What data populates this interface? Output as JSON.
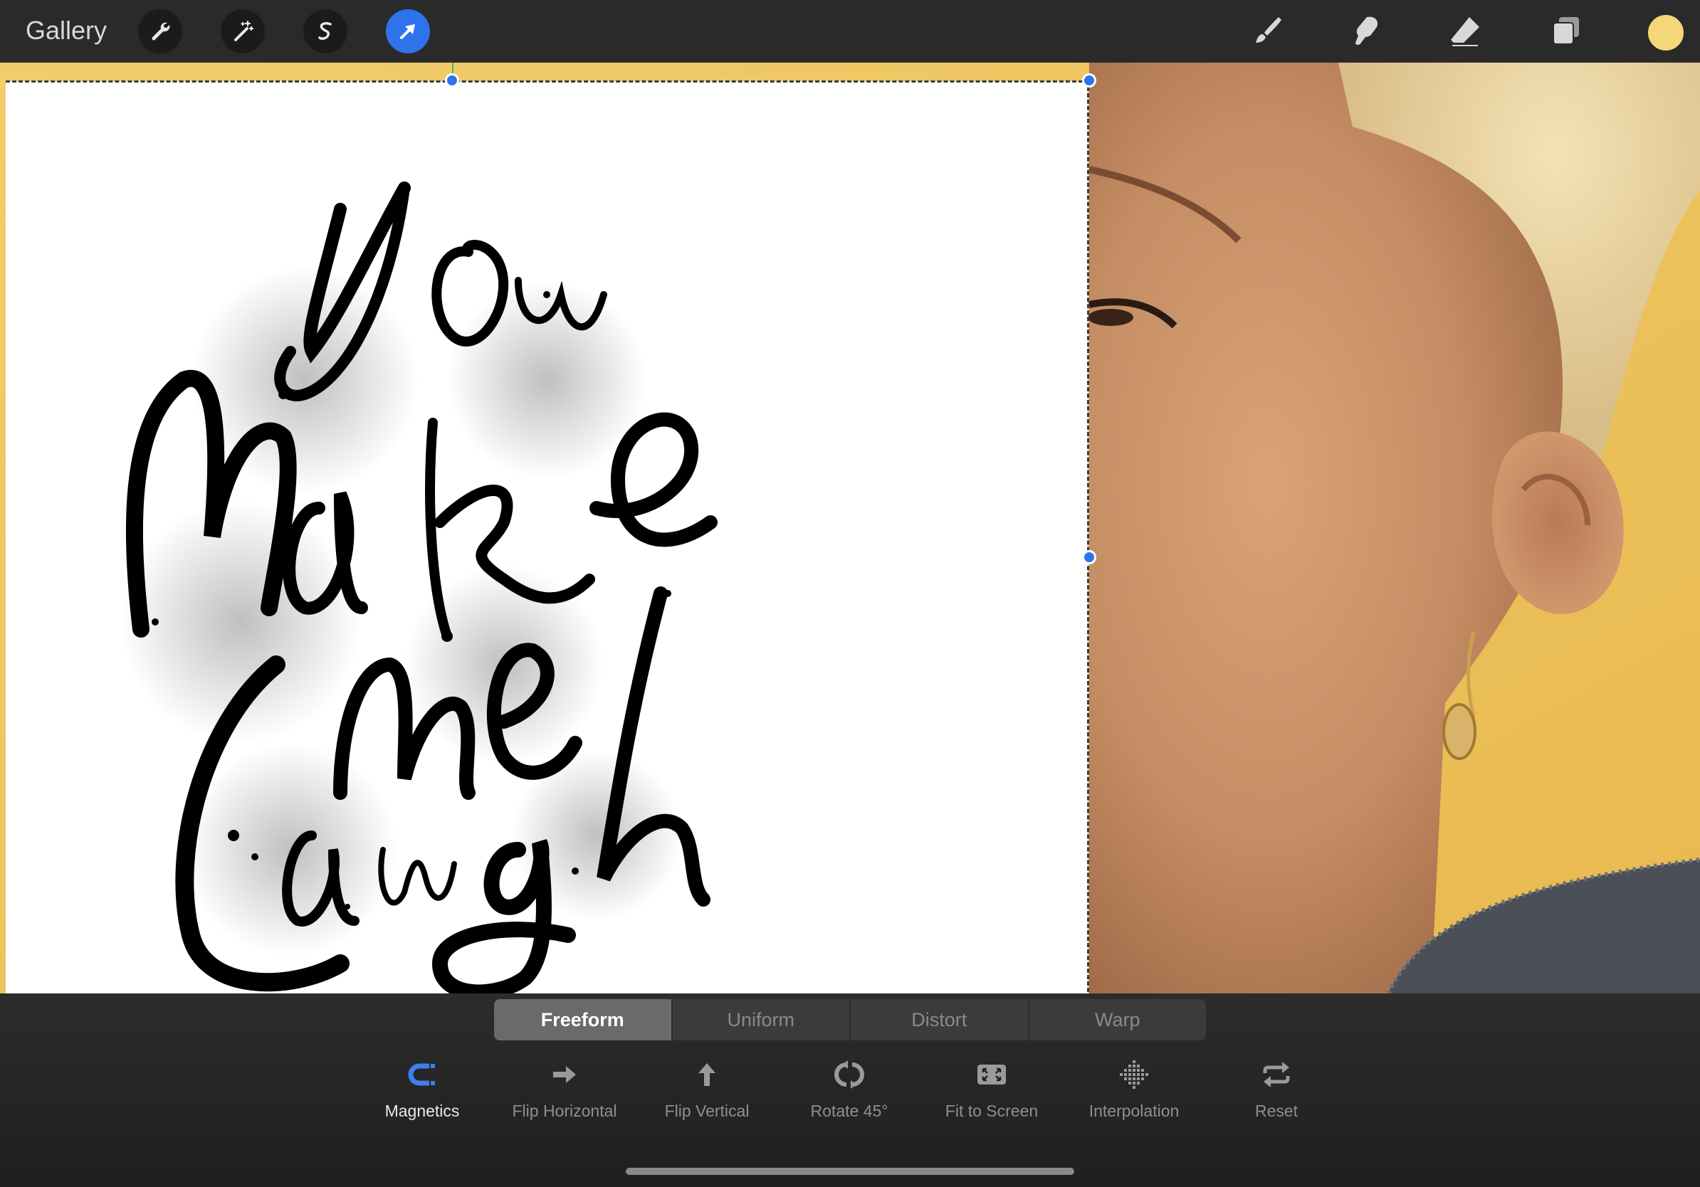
{
  "app": {
    "gallery_label": "Gallery",
    "current_color": "#f5d77a",
    "accent_color": "#2f73ec"
  },
  "toolbar": {
    "left_tools": [
      {
        "name": "Actions",
        "icon": "wrench-icon"
      },
      {
        "name": "Adjustments",
        "icon": "magic-wand-icon"
      },
      {
        "name": "Selection",
        "icon": "selection-s-icon"
      },
      {
        "name": "Transform",
        "icon": "arrow-cursor-icon",
        "active": true
      }
    ],
    "right_tools": [
      {
        "name": "Brush",
        "icon": "brush-icon"
      },
      {
        "name": "Smudge",
        "icon": "smudge-icon"
      },
      {
        "name": "Eraser",
        "icon": "eraser-icon"
      },
      {
        "name": "Layers",
        "icon": "layers-icon"
      }
    ]
  },
  "transform": {
    "modes": [
      "Freeform",
      "Uniform",
      "Distort",
      "Warp"
    ],
    "active_mode": "Freeform",
    "actions": [
      {
        "label": "Magnetics",
        "icon": "magnet-icon",
        "active": true
      },
      {
        "label": "Flip Horizontal",
        "icon": "arrow-right-icon"
      },
      {
        "label": "Flip Vertical",
        "icon": "arrow-up-icon"
      },
      {
        "label": "Rotate 45°",
        "icon": "rotate-icon"
      },
      {
        "label": "Fit to Screen",
        "icon": "fit-screen-icon"
      },
      {
        "label": "Interpolation",
        "icon": "interpolation-icon"
      },
      {
        "label": "Reset",
        "icon": "reset-icon"
      }
    ]
  }
}
